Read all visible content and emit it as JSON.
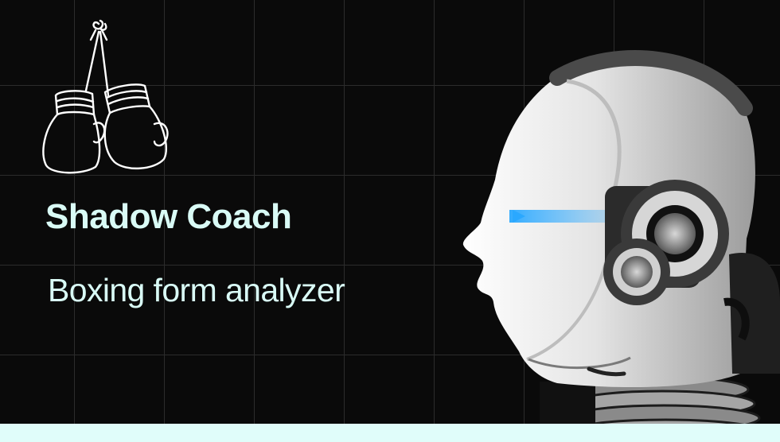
{
  "slide": {
    "title": "Shadow Coach",
    "subtitle": "Boxing form analyzer"
  },
  "icons": {
    "gloves": "boxing-gloves-icon",
    "robot": "robot-head-illustration"
  },
  "colors": {
    "background": "#0a0a0a",
    "grid": "#2c2c2c",
    "text": "#d9fbf6",
    "bottom_bar": "#e0fdfa",
    "eye_beam": "#2aa8ff"
  }
}
